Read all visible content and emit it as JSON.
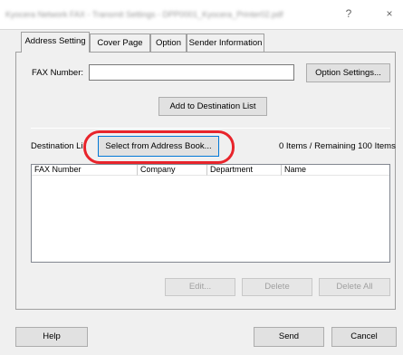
{
  "window": {
    "title": "Kyocera Network FAX - Transmit Settings - DPP0001_Kyocera_Printer02.pdf",
    "help_glyph": "?",
    "close_glyph": "×"
  },
  "tabs": [
    {
      "label": "Address Setting"
    },
    {
      "label": "Cover Page"
    },
    {
      "label": "Option"
    },
    {
      "label": "Sender Information"
    }
  ],
  "fax_number": {
    "label": "FAX Number:",
    "value": ""
  },
  "buttons": {
    "option_settings": "Option Settings...",
    "add_to_destination": "Add to Destination List",
    "select_from_address_book": "Select from Address Book...",
    "edit": "Edit...",
    "delete": "Delete",
    "delete_all": "Delete All",
    "help": "Help",
    "send": "Send",
    "cancel": "Cancel"
  },
  "destination": {
    "label": "Destination Li",
    "status": "0 Items / Remaining 100 Items",
    "columns": [
      "FAX Number",
      "Company",
      "Department",
      "Name"
    ],
    "rows": []
  },
  "colors": {
    "highlight": "#e8242b",
    "focus": "#0078d7"
  }
}
